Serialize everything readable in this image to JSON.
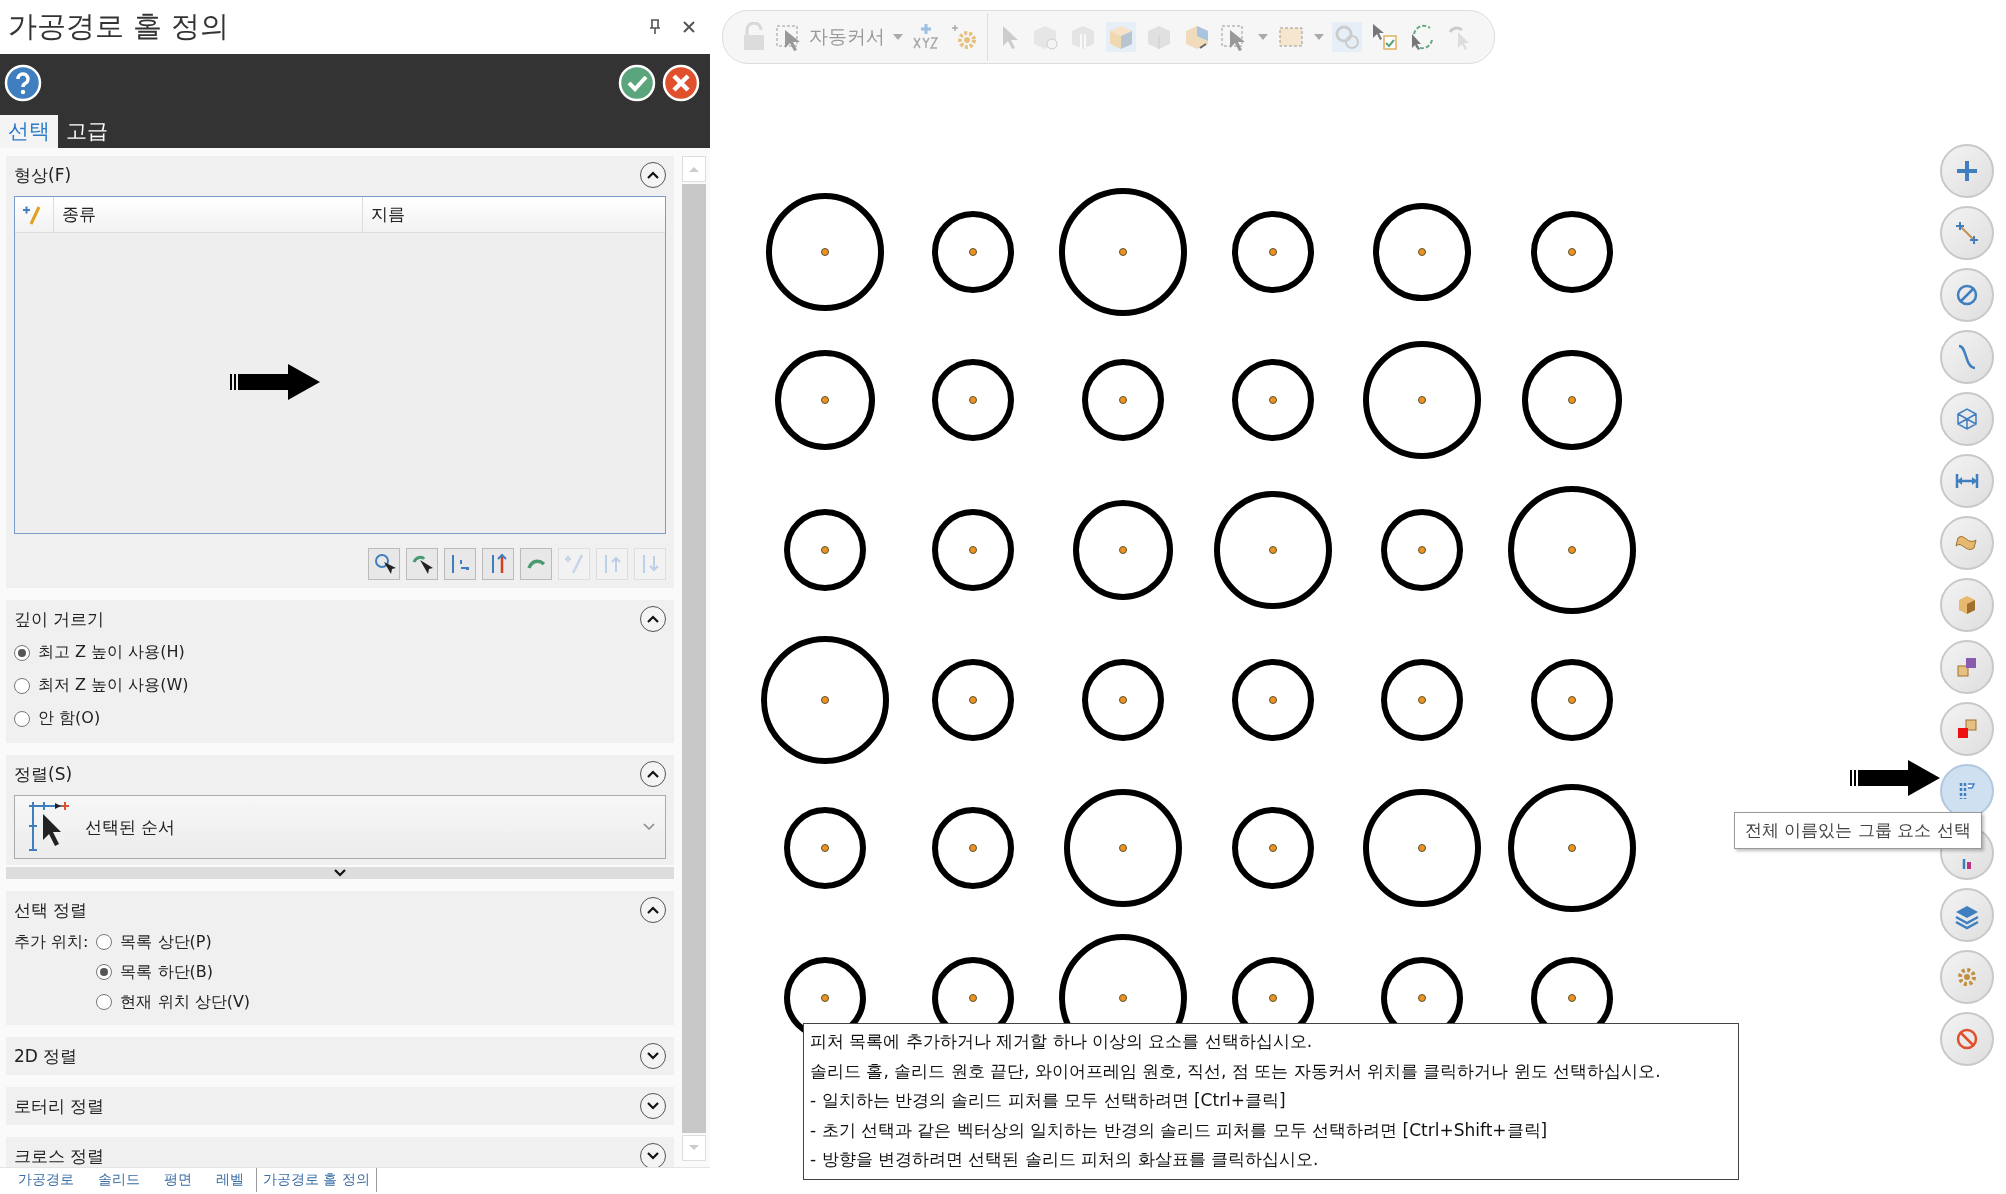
{
  "panel": {
    "title": "가공경로 홀 정의",
    "tabs": [
      {
        "label": "선택",
        "selected": true
      },
      {
        "label": "고급",
        "selected": false
      }
    ],
    "geometry": {
      "header": "형상(F)",
      "columns": [
        "종류",
        "지름"
      ]
    },
    "depth_filter": {
      "header": "깊이 거르기",
      "options": [
        {
          "label": "최고 Z 높이 사용(H)",
          "selected": true
        },
        {
          "label": "최저 Z 높이 사용(W)",
          "selected": false
        },
        {
          "label": "안 함(O)",
          "selected": false
        }
      ]
    },
    "sorting": {
      "header": "정렬(S)",
      "value": "선택된 순서"
    },
    "selection_sort": {
      "header": "선택 정렬",
      "label": "추가 위치:",
      "options": [
        {
          "label": "목록 상단(P)",
          "selected": false
        },
        {
          "label": "목록 하단(B)",
          "selected": true
        },
        {
          "label": "현재 위치 상단(V)",
          "selected": false
        }
      ]
    },
    "collapsed_sections": [
      "2D 정렬",
      "로터리 정렬",
      "크로스 정렬"
    ]
  },
  "bottom_tabs": [
    {
      "label": "가공경로",
      "selected": false
    },
    {
      "label": "솔리드",
      "selected": false
    },
    {
      "label": "평면",
      "selected": false
    },
    {
      "label": "레벨",
      "selected": false
    },
    {
      "label": "가공경로 홀 정의",
      "selected": true
    }
  ],
  "toolbar": {
    "autocursor": "자동커서"
  },
  "side_tools": [
    {
      "selected": false
    },
    {
      "selected": false
    },
    {
      "selected": false
    },
    {
      "selected": false
    },
    {
      "selected": false
    },
    {
      "selected": false
    },
    {
      "selected": false
    },
    {
      "selected": false
    },
    {
      "selected": false
    },
    {
      "selected": false
    },
    {
      "selected": true
    },
    {
      "selected": false
    },
    {
      "selected": false
    },
    {
      "selected": false
    },
    {
      "selected": false
    }
  ],
  "tooltip": "전체 이름있는 그룹 요소 선택",
  "prompt": [
    "피처 목록에 추가하거나 제거할 하나 이상의 요소를 선택하십시오.",
    "솔리드 홀, 솔리드 원호 끝단, 와이어프레임 원호, 직선, 점 또는 자동커서 위치를 클릭하거나 윈도 선택하십시오.",
    "- 일치하는 반경의 솔리드 피처를 모두 선택하려면 [Ctrl+클릭]",
    "- 초기 선택과 같은 벡터상의 일치하는 반경의 솔리드 피처를 모두 선택하려면 [Ctrl+Shift+클릭]",
    "- 방향을 변경하려면 선택된 솔리드 피처의 화살표를 클릭하십시오."
  ]
}
